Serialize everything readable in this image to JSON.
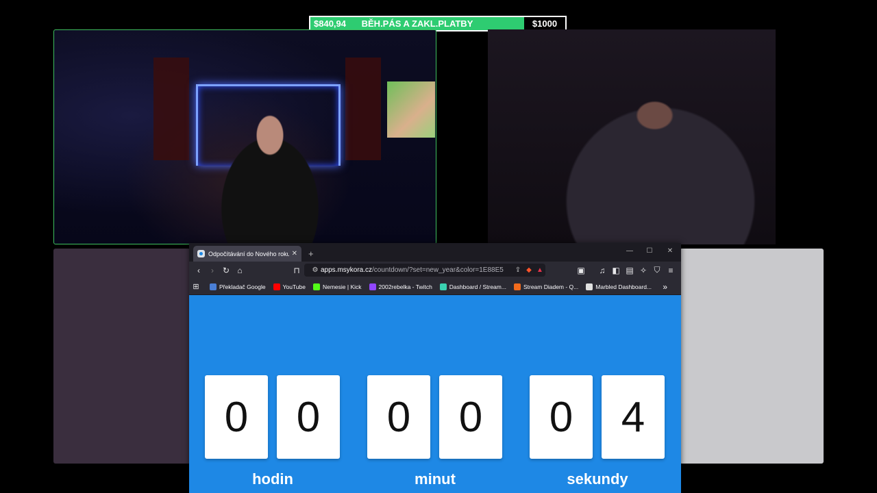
{
  "goal": {
    "current": "$840,94",
    "title": "BĚH.PÁS A ZAKL.PLATBY",
    "target": "$1000",
    "progress_fraction": 0.84,
    "fill_color": "#2ecc71"
  },
  "browser": {
    "tab_title": "Odpočítávání do Nového roku | M",
    "tab_close": "✕",
    "new_tab": "+",
    "url_domain": "apps.msykora.cz",
    "url_rest": "/countdown/?set=new_year&color=1E88E5",
    "bookmarks": [
      {
        "label": "Překladač Google",
        "icon_color": "#4a7fd6"
      },
      {
        "label": "YouTube",
        "icon_color": "#ff0000"
      },
      {
        "label": "Nemesie | Kick",
        "icon_color": "#53fc18"
      },
      {
        "label": "2002rebelka - Twitch",
        "icon_color": "#9146ff"
      },
      {
        "label": "Dashboard / Stream...",
        "icon_color": "#3ad1b0"
      },
      {
        "label": "Stream Diadem - Q...",
        "icon_color": "#f26b1d"
      },
      {
        "label": "Marbled Dashboard...",
        "icon_color": "#e0e0e0"
      }
    ],
    "bookmarks_overflow": "»"
  },
  "countdown": {
    "background_color": "#1E88E5",
    "digits": [
      "0",
      "0",
      "0",
      "0",
      "0",
      "4"
    ],
    "units": [
      "hodin",
      "minut",
      "sekundy"
    ]
  }
}
